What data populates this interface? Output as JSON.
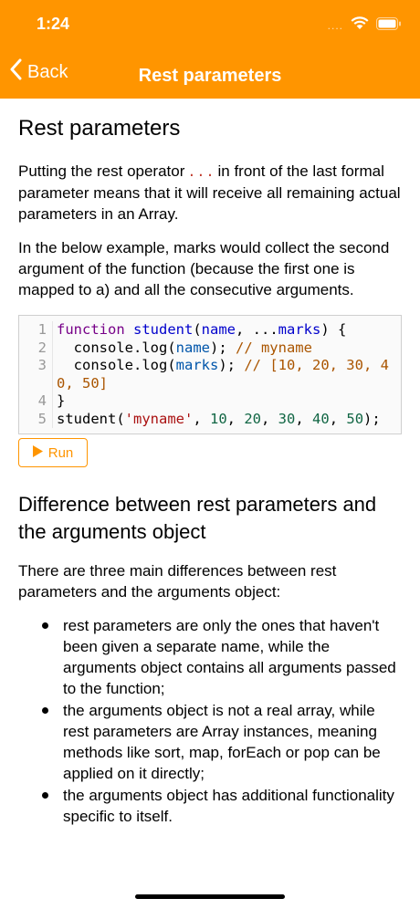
{
  "status_bar": {
    "time": "1:24",
    "signal_dots": "....",
    "wifi_icon": "wifi-icon",
    "battery_icon": "battery-icon"
  },
  "nav": {
    "back_label": "Back",
    "title": "Rest parameters",
    "colors": {
      "bar": "#ff9500",
      "text": "#ffffff"
    }
  },
  "article": {
    "heading": "Rest parameters",
    "para1_before": "Putting the rest operator",
    "para1_code": "...",
    "para1_after": "in front of the last formal parameter means that it will receive all remaining actual parameters in an Array.",
    "para2": "In the below example, marks would collect the second argument of the function (because the first one is mapped to a) and all the consecutive arguments.",
    "code": {
      "line_numbers": [
        "1",
        "2",
        "3",
        "4",
        "5"
      ],
      "l1_kw": "function",
      "l1_fn": "student",
      "l1_open": "(",
      "l1_name": "name",
      "l1_sep": ", ...",
      "l1_marks": "marks",
      "l1_close": ") {",
      "l2_pre": "  console.log(",
      "l2_var": "name",
      "l2_post": "); ",
      "l2_comment": "// myname",
      "l3_pre": "  console.log(",
      "l3_var": "marks",
      "l3_post": "); ",
      "l3_comment": "// [10, 20, 30, 40, 50]",
      "l4": "}",
      "l5_fn": "student(",
      "l5_str": "'myname'",
      "l5_sep": ", ",
      "l5_n1": "10",
      "l5_n2": "20",
      "l5_n3": "30",
      "l5_n4": "40",
      "l5_n5": "50",
      "l5_comma": ", ",
      "l5_end": ");"
    },
    "run_label": "Run",
    "heading2": "Difference between rest parameters and the arguments object",
    "para3": "There are three main differences between rest parameters and the arguments object:",
    "bullets": [
      "rest parameters are only the ones that haven't been given a separate name, while the arguments object contains all arguments passed to the function;",
      "the arguments object is not a real array, while rest parameters are Array instances, meaning methods like sort, map, forEach or pop can be applied on it directly;",
      "the arguments object has additional functionality specific to itself."
    ]
  }
}
